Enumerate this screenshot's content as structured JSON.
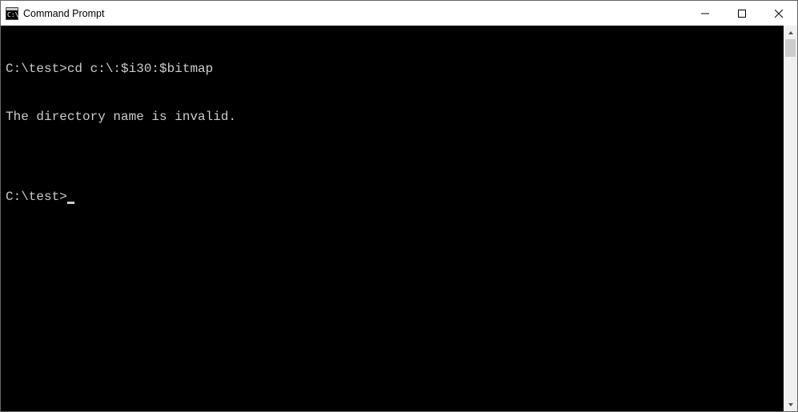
{
  "window": {
    "title": "Command Prompt"
  },
  "terminal": {
    "lines": [
      {
        "prompt": "C:\\test>",
        "command": "cd c:\\:$i30:$bitmap"
      },
      {
        "output": "The directory name is invalid."
      },
      {
        "blank": ""
      },
      {
        "prompt": "C:\\test>",
        "cursor": true
      }
    ]
  }
}
